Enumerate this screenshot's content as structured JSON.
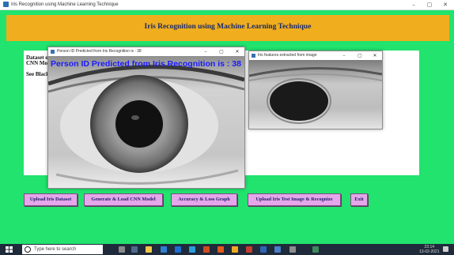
{
  "app": {
    "title": "Iris Recognition using Machine Learning Technique",
    "window_controls": [
      "–",
      "▢",
      "✕"
    ]
  },
  "header": {
    "title": "Iris Recognition using Machine Learning Technique"
  },
  "panel": {
    "line1": "Dataset o",
    "line2": "CNN Mo",
    "line3": "See Black"
  },
  "predict_window": {
    "title": "Person ID Predicted from Iris Recognition is : 38",
    "overlay_text": "Person ID Predicted from Iris Recognition is : 38"
  },
  "features_window": {
    "title": "Iris features extracted from image"
  },
  "buttons": {
    "upload_dataset": "Upload Iris Dataset",
    "generate_model": "Generate & Load CNN Model",
    "accuracy_graph": "Accuracy & Loss Graph",
    "upload_test": "Upload Iris Test Image & Recognize",
    "exit": "Exit"
  },
  "taskbar": {
    "search_placeholder": "Type here to search",
    "time": "23:14",
    "date": "13-02-2021"
  },
  "colors": {
    "background": "#21e36e",
    "header": "#f0ad1d",
    "button": "#e5a6ea",
    "overlay_text": "#1a1aff"
  }
}
